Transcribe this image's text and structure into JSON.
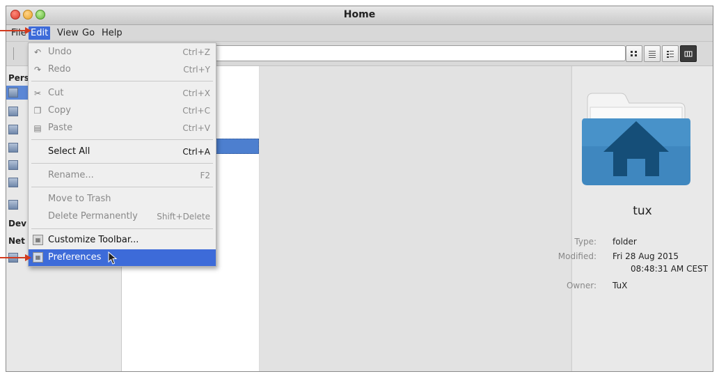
{
  "window": {
    "title": "Home"
  },
  "menubar": {
    "items": [
      {
        "label": "File",
        "active": false
      },
      {
        "label": "Edit",
        "active": true
      },
      {
        "label": "View",
        "active": false
      },
      {
        "label": "Go",
        "active": false
      },
      {
        "label": "Help",
        "active": false
      }
    ]
  },
  "sidebar": {
    "headers": [
      "Pers",
      "Dev",
      "Net"
    ]
  },
  "edit_menu": {
    "items": [
      {
        "label": "Undo",
        "shortcut": "Ctrl+Z",
        "icon": "undo-icon",
        "state": "disabled"
      },
      {
        "label": "Redo",
        "shortcut": "Ctrl+Y",
        "icon": "redo-icon",
        "state": "disabled"
      },
      {
        "label": "Cut",
        "shortcut": "Ctrl+X",
        "icon": "scissors-icon",
        "state": "disabled"
      },
      {
        "label": "Copy",
        "shortcut": "Ctrl+C",
        "icon": "copy-icon",
        "state": "disabled"
      },
      {
        "label": "Paste",
        "shortcut": "Ctrl+V",
        "icon": "paste-icon",
        "state": "disabled"
      },
      {
        "label": "Select All",
        "shortcut": "Ctrl+A",
        "state": "enabled"
      },
      {
        "label": "Rename...",
        "shortcut": "F2",
        "state": "disabled"
      },
      {
        "label": "Move to Trash",
        "shortcut": "",
        "state": "disabled"
      },
      {
        "label": "Delete Permanently",
        "shortcut": "Shift+Delete",
        "state": "disabled"
      },
      {
        "label": "Customize Toolbar...",
        "shortcut": "",
        "icon": "toolbar-icon",
        "state": "enabled"
      },
      {
        "label": "Preferences",
        "shortcut": "",
        "icon": "preferences-icon",
        "state": "highlighted"
      }
    ]
  },
  "info_panel": {
    "name": "tux",
    "type_label": "Type:",
    "type_value": "folder",
    "modified_label": "Modified:",
    "modified_value_1": "Fri 28 Aug 2015",
    "modified_value_2": "08:48:31 AM CEST",
    "owner_label": "Owner:",
    "owner_value": "TuX"
  },
  "colors": {
    "accent": "#3d6bd9",
    "annotation_arrow": "#d23a1e"
  }
}
